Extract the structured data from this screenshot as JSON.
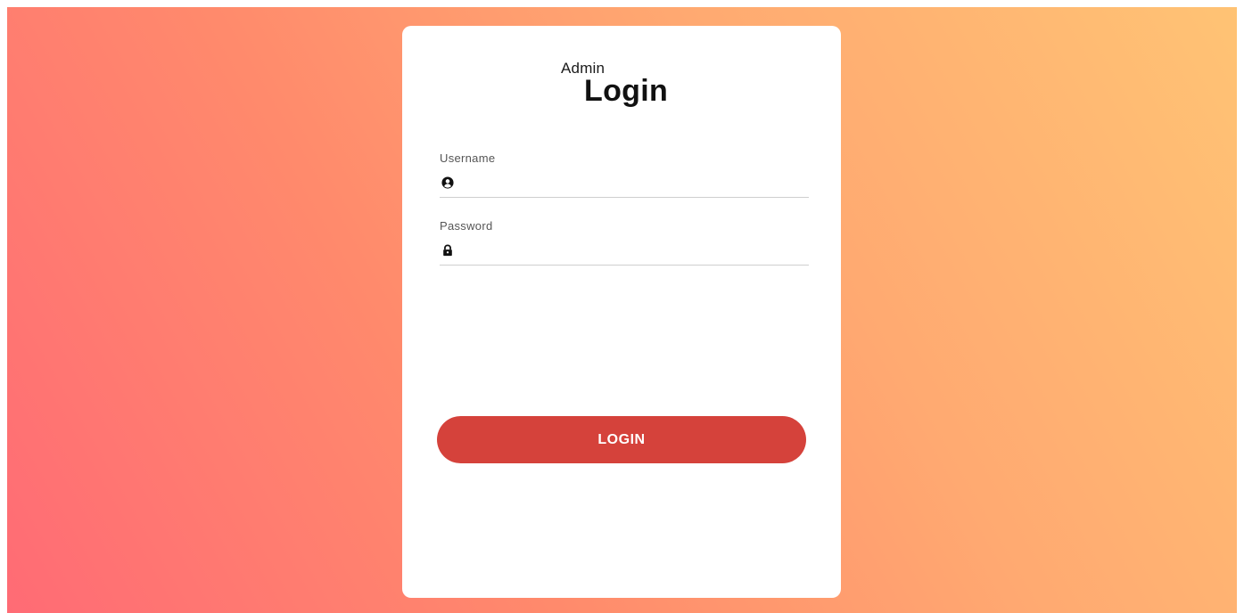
{
  "colors": {
    "background_gradient": [
      "#ff6b75",
      "#ff8a6c",
      "#ffa971",
      "#ffc374"
    ],
    "card": "#ffffff",
    "button": "#d5423b",
    "button_text": "#ffffff"
  },
  "header": {
    "subtitle": "Admin",
    "title": "Login"
  },
  "form": {
    "username": {
      "label": "Username",
      "value": "",
      "icon": "user-circle-icon"
    },
    "password": {
      "label": "Password",
      "value": "",
      "icon": "lock-icon"
    },
    "submit_label": "LOGIN"
  }
}
